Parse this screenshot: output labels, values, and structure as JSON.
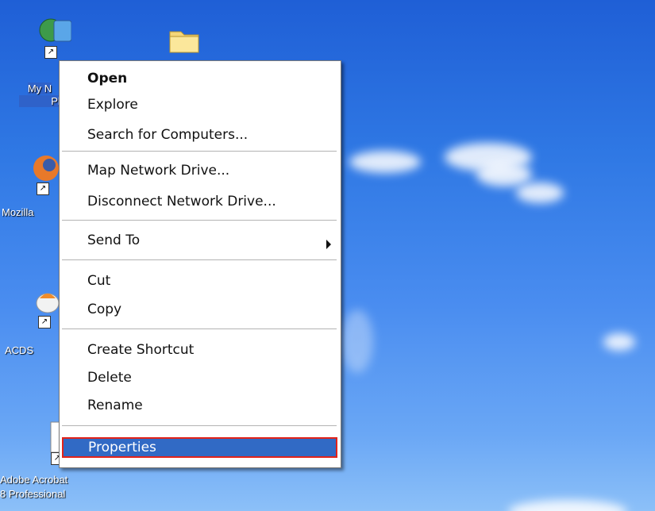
{
  "desktop": {
    "icons": [
      {
        "label_lines": [
          "My N",
          "Pl"
        ],
        "icon": "network-places-icon"
      },
      {
        "label_lines": [
          "Mozilla"
        ],
        "icon": "firefox-icon"
      },
      {
        "label_lines": [
          "ACDS"
        ],
        "icon": "acdsee-icon"
      },
      {
        "label_lines": [
          "Adobe Acrobat",
          "8 Professional"
        ],
        "icon": "acrobat-icon"
      },
      {
        "label_lines": [],
        "icon": "folder-icon"
      }
    ]
  },
  "context_menu": {
    "items": [
      {
        "label": "Open",
        "default": true
      },
      {
        "label": "Explore"
      },
      {
        "label": "Search for Computers..."
      },
      {
        "label": "Map Network Drive..."
      },
      {
        "label": "Disconnect Network Drive..."
      },
      {
        "label": "Send To",
        "submenu": true
      },
      {
        "label": "Cut"
      },
      {
        "label": "Copy"
      },
      {
        "label": "Create Shortcut"
      },
      {
        "label": "Delete"
      },
      {
        "label": "Rename"
      },
      {
        "label": "Properties",
        "highlighted": true
      }
    ],
    "highlight_color": "#316ac5",
    "annotation_color": "#e2231a"
  },
  "shortcut_glyph": "↗"
}
